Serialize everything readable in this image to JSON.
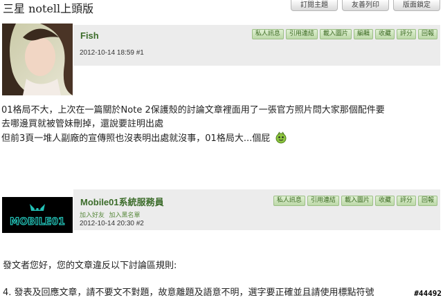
{
  "header": {
    "title": "三星 notell上頭版",
    "tabs": [
      "訂閱主題",
      "友善列印",
      "版面鎖定"
    ]
  },
  "actions": [
    "私人訊息",
    "引用連結",
    "載入圖片",
    "編輯",
    "收藏",
    "評分",
    "回報"
  ],
  "actions_short": [
    "私人訊息",
    "引用連結",
    "載入圖片",
    "收藏",
    "評分",
    "回報"
  ],
  "posts": [
    {
      "author": "Fish",
      "datetime": "2012-10-14 18:59",
      "floor": "#1",
      "lines": [
        "01格局不大，上次在一篇關於Note 2保護殼的討論文章裡面用了一張官方照片問大家那個配件要",
        "去哪邊買就被管妹刪掉，還說要註明出處",
        "但前3頁一堆人副廠的宣傳照也沒表明出處就沒事，01格局大...個屁"
      ]
    },
    {
      "author": "Mobile01系統服務員",
      "add_friend": "加入好友",
      "add_blacklist": "加入黑名單",
      "datetime": "2012-10-14 20:30",
      "floor": "#2",
      "logo_text": "MOBILE01",
      "lines": [
        "發文者您好，您的文章違反以下討論區規則:",
        "4. 發表及回應文章，請不要文不對題，故意離題及語意不明，選字要正確並且請使用標點符號"
      ]
    }
  ],
  "watermark": "#44492"
}
